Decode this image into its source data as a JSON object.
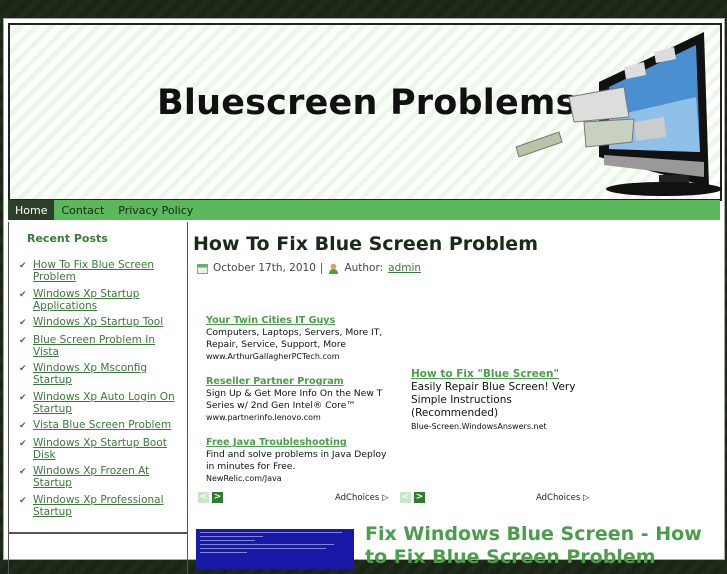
{
  "site": {
    "title": "Bluescreen Problems"
  },
  "nav": {
    "items": [
      {
        "label": "Home",
        "active": true
      },
      {
        "label": "Contact",
        "active": false
      },
      {
        "label": "Privacy Policy",
        "active": false
      }
    ]
  },
  "sidebar": {
    "recent_title": "Recent Posts",
    "posts": [
      "How To Fix Blue Screen Problem",
      "Windows Xp Startup Applications",
      "Windows Xp Startup Tool",
      "Blue Screen Problem In Vista",
      "Windows Xp Msconfig Startup",
      "Windows Xp Auto Login On Startup",
      "Vista Blue Screen Problem",
      "Windows Xp Startup Boot Disk",
      "Windows Xp Frozen At Startup",
      "Windows Xp Professional Startup"
    ]
  },
  "post": {
    "title": "How To Fix Blue Screen Problem",
    "date": "October 17th, 2010",
    "separator": "|",
    "author_label": "Author:",
    "author": "admin"
  },
  "ads_left": [
    {
      "title": "Your Twin Cities IT Guys",
      "body": "Computers, Laptops, Servers, More IT, Repair, Service, Support, More",
      "url": "www.ArthurGallagherPCTech.com"
    },
    {
      "title": "Reseller Partner Program",
      "body": "Sign Up & Get More Info On the New T Series w/ 2nd Gen Intel® Core™",
      "url": "www.partnerinfo.lenovo.com"
    },
    {
      "title": "Free Java Troubleshooting",
      "body": "Find and solve problems in Java Deploy in minutes for Free.",
      "url": "NewRelic.com/Java"
    }
  ],
  "ads_right": [
    {
      "title": "How to Fix \"Blue Screen\"",
      "body": "Easily Repair Blue Screen! Very Simple Instructions (Recommended)",
      "url": "Blue-Screen.WindowsAnswers.net"
    }
  ],
  "ad_controls": {
    "prev": "<",
    "next": ">",
    "adchoices": "AdChoices ▷"
  },
  "feature": {
    "title": "Fix Windows Blue Screen - How to Fix Blue Screen Problem"
  },
  "colors": {
    "accent": "#5cb85c",
    "link": "#3a7a3a",
    "nav_active": "#2c3f2a",
    "bsod": "#1919a8"
  }
}
